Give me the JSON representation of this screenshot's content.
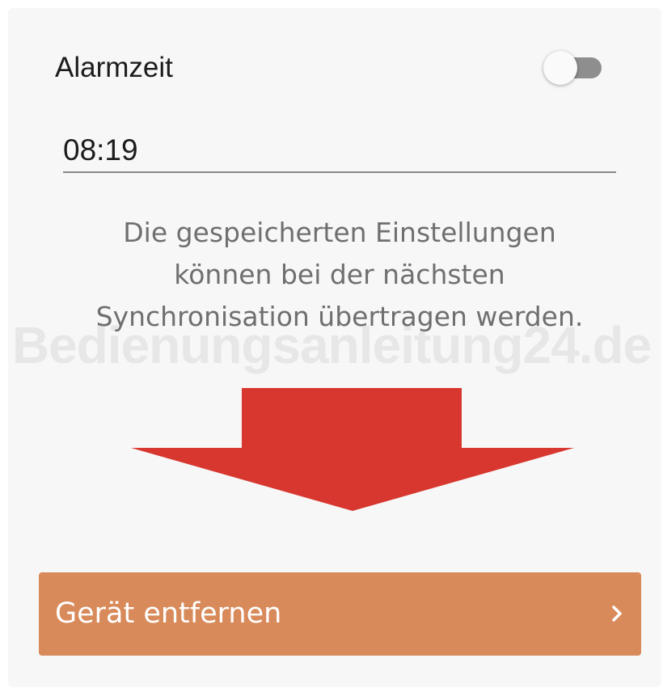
{
  "alarm": {
    "label": "Alarmzeit",
    "toggle_on": false,
    "time_value": "08:19"
  },
  "info": {
    "lines": [
      "Die gespeicherten Einstellungen",
      "können bei der nächsten",
      "Synchronisation übertragen werden."
    ]
  },
  "watermark": "Bedienungsanleitung24.de",
  "arrow": {
    "icon": "arrow-down-icon",
    "color": "#d7372f"
  },
  "remove_button": {
    "label": "Gerät entfernen",
    "icon": "chevron-right-icon",
    "color": "#d88a5a"
  }
}
